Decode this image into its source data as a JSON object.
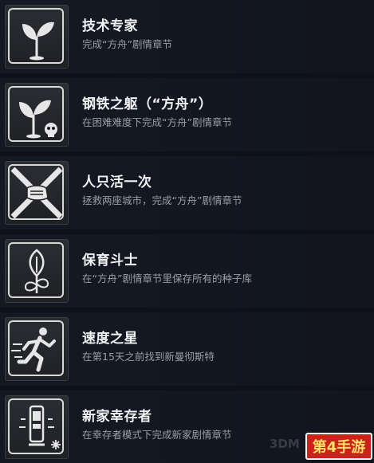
{
  "achievements": [
    {
      "title": "技术专家",
      "desc": "完成“方舟”剧情章节",
      "icon": "sprout-icon"
    },
    {
      "title": "钢铁之躯（“方舟”）",
      "desc": "在困难难度下完成“方舟”剧情章节",
      "icon": "sprout-skull-icon"
    },
    {
      "title": "人只活一次",
      "desc": "拯救两座城市，完成“方舟”剧情章节",
      "icon": "cross-hands-icon"
    },
    {
      "title": "保育斗士",
      "desc": "在“方舟”剧情章节里保存所有的种子库",
      "icon": "flower-bud-icon"
    },
    {
      "title": "速度之星",
      "desc": "在第15天之前找到新曼彻斯特",
      "icon": "running-man-icon"
    },
    {
      "title": "新家幸存者",
      "desc": "在幸存者模式下完成新家剧情章节",
      "icon": "generator-snowflake-icon"
    }
  ],
  "watermark": {
    "text": "3DM",
    "brand": "第4手游"
  },
  "colors": {
    "background": "#0e1118",
    "title": "#f2f2f2",
    "desc": "#9a9ea6",
    "icon_stroke": "#d9d9d9",
    "brand": "#c9231c"
  }
}
